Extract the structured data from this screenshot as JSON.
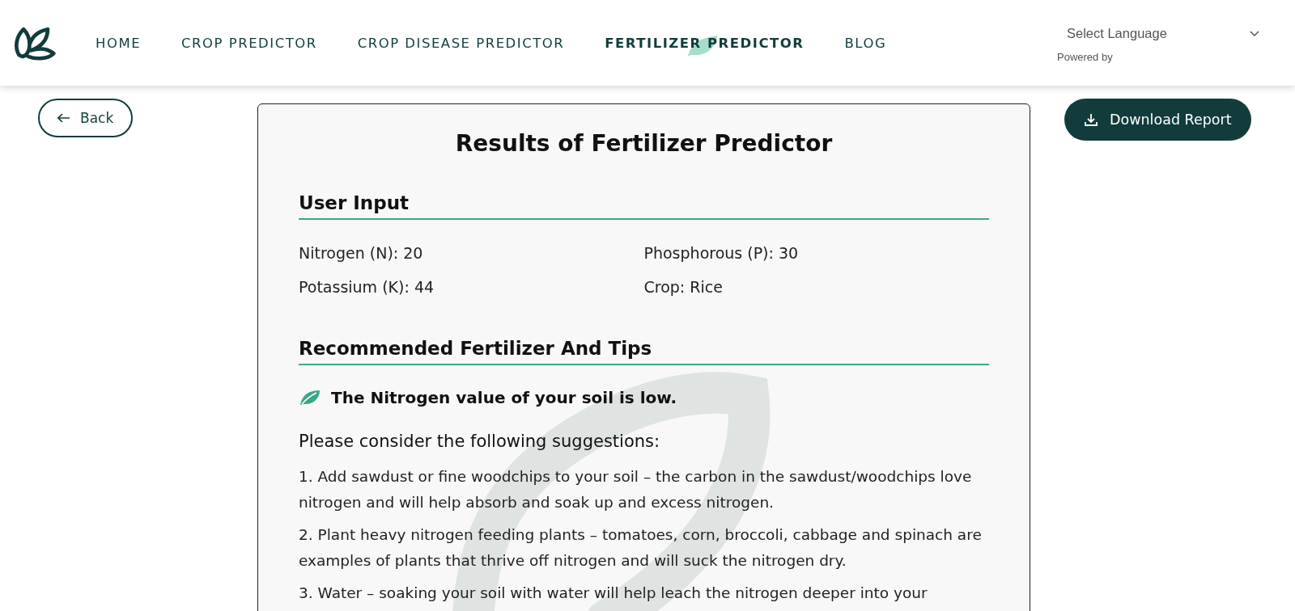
{
  "nav": {
    "items": [
      {
        "label": "HOME",
        "selected": false
      },
      {
        "label": "CROP PREDICTOR",
        "selected": false
      },
      {
        "label": "CROP DISEASE PREDICTOR",
        "selected": false
      },
      {
        "label": "FERTILIZER PREDICTOR",
        "selected": true
      },
      {
        "label": "BLOG",
        "selected": false
      }
    ]
  },
  "language": {
    "placeholder": "Select Language",
    "powered_by": "Powered by"
  },
  "back_button": "Back",
  "download_button": "Download Report",
  "result": {
    "title": "Results of Fertilizer Predictor",
    "input_heading": "User Input",
    "inputs": [
      "Nitrogen (N): 20",
      "Phosphorous (P): 30",
      "Potassium (K): 44",
      "Crop: Rice"
    ],
    "recommend_heading": "Recommended Fertilizer And Tips",
    "finding": "The Nitrogen value of your soil is low.",
    "suggestions_heading": "Please consider the following suggestions:",
    "suggestions": [
      "1. Add sawdust or fine woodchips to your soil – the carbon in the sawdust/woodchips love nitrogen and will help absorb and soak up and excess nitrogen.",
      "2. Plant heavy nitrogen feeding plants – tomatoes, corn, broccoli, cabbage and spinach are examples of plants that thrive off nitrogen and will suck the nitrogen dry.",
      "3. Water – soaking your soil with water will help leach the nitrogen deeper into your"
    ]
  }
}
